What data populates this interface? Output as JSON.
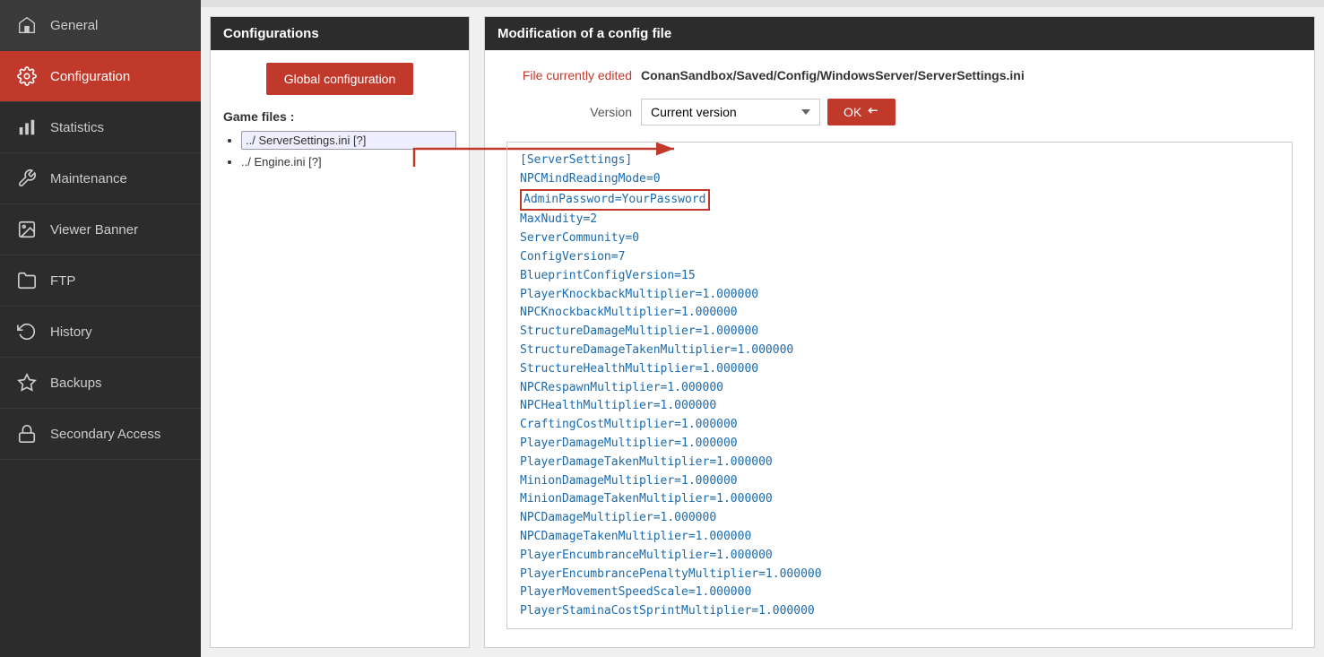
{
  "sidebar": {
    "items": [
      {
        "id": "general",
        "label": "General",
        "icon": "home-icon",
        "active": false
      },
      {
        "id": "configuration",
        "label": "Configuration",
        "icon": "config-icon",
        "active": true
      },
      {
        "id": "statistics",
        "label": "Statistics",
        "icon": "stats-icon",
        "active": false
      },
      {
        "id": "maintenance",
        "label": "Maintenance",
        "icon": "maintenance-icon",
        "active": false
      },
      {
        "id": "viewer-banner",
        "label": "Viewer Banner",
        "icon": "image-icon",
        "active": false
      },
      {
        "id": "ftp",
        "label": "FTP",
        "icon": "folder-icon",
        "active": false
      },
      {
        "id": "history",
        "label": "History",
        "icon": "history-icon",
        "active": false
      },
      {
        "id": "backups",
        "label": "Backups",
        "icon": "backup-icon",
        "active": false
      },
      {
        "id": "secondary-access",
        "label": "Secondary Access",
        "icon": "lock-icon",
        "active": false
      }
    ]
  },
  "config_panel": {
    "header": "Configurations",
    "global_config_btn": "Global configuration",
    "game_files_label": "Game files :",
    "files": [
      {
        "name": "../ ServerSettings.ini [?]",
        "selected": true
      },
      {
        "name": "../ Engine.ini [?]",
        "selected": false
      }
    ]
  },
  "mod_panel": {
    "header": "Modification of a config file",
    "file_label": "File currently edited",
    "file_path": "ConanSandbox/Saved/Config/WindowsServer/ServerSettings.ini",
    "version_label": "Version",
    "version_current": "Current version",
    "ok_label": "OK",
    "content_lines": [
      "[ServerSettings]",
      "NPCMindReadingMode=0",
      "AdminPassword=YourPassword",
      "MaxNudity=2",
      "ServerCommunity=0",
      "ConfigVersion=7",
      "BlueprintConfigVersion=15",
      "PlayerKnockbackMultiplier=1.000000",
      "NPCKnockbackMultiplier=1.000000",
      "StructureDamageMultiplier=1.000000",
      "StructureDamageTakenMultiplier=1.000000",
      "StructureHealthMultiplier=1.000000",
      "NPCRespawnMultiplier=1.000000",
      "NPCHealthMultiplier=1.000000",
      "CraftingCostMultiplier=1.000000",
      "PlayerDamageMultiplier=1.000000",
      "PlayerDamageTakenMultiplier=1.000000",
      "MinionDamageMultiplier=1.000000",
      "MinionDamageTakenMultiplier=1.000000",
      "NPCDamageMultiplier=1.000000",
      "NPCDamageTakenMultiplier=1.000000",
      "PlayerEncumbranceMultiplier=1.000000",
      "PlayerEncumbrancePenaltyMultiplier=1.000000",
      "PlayerMovementSpeedScale=1.000000",
      "PlayerStaminaCostSprintMultiplier=1.000000"
    ],
    "highlighted_line_index": 2
  }
}
